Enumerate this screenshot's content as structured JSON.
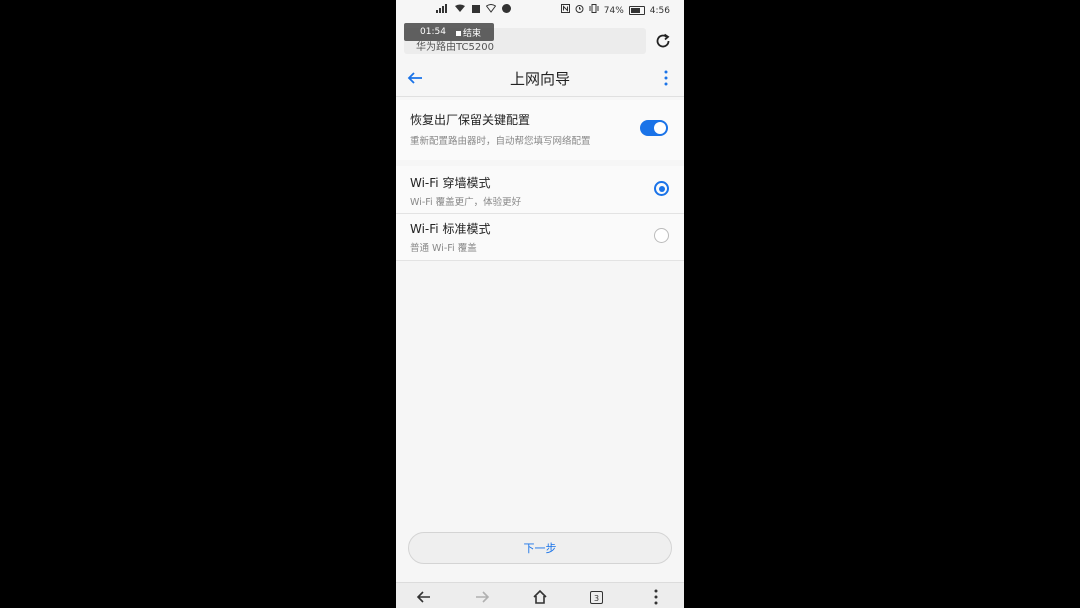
{
  "status_bar": {
    "battery_percent": "74%",
    "time": "4:56"
  },
  "recording": {
    "elapsed": "01:54",
    "stop_label": "结束"
  },
  "url_bar": {
    "text": "华为路由TC5200"
  },
  "header": {
    "title": "上网向导"
  },
  "restore_config": {
    "title": "恢复出厂保留关键配置",
    "subtitle": "重新配置路由器时，自动帮您填写网络配置",
    "enabled": true
  },
  "modes": [
    {
      "title": "Wi-Fi 穿墙模式",
      "subtitle": "Wi-Fi 覆盖更广，体验更好",
      "selected": true
    },
    {
      "title": "Wi-Fi 标准模式",
      "subtitle": "普通 Wi-Fi 覆盖",
      "selected": false
    }
  ],
  "next_button": {
    "label": "下一步"
  },
  "bottom_bar": {
    "tab_count": "3"
  },
  "colors": {
    "accent": "#1a73e8",
    "background": "#f6f6f6"
  }
}
